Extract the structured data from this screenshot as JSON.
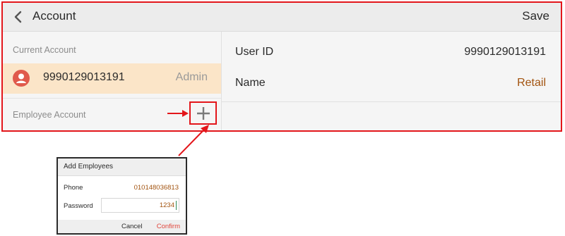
{
  "header": {
    "title": "Account",
    "save_label": "Save"
  },
  "current_account": {
    "section_label": "Current Account",
    "id": "9990129013191",
    "role": "Admin"
  },
  "employee_account": {
    "section_label": "Employee Account"
  },
  "details": {
    "user_id_label": "User ID",
    "user_id_value": "9990129013191",
    "name_label": "Name",
    "name_value": "Retail"
  },
  "dialog": {
    "title": "Add Employees",
    "phone_label": "Phone",
    "phone_value": "010148036813",
    "password_label": "Password",
    "password_value": "1234",
    "cancel_label": "Cancel",
    "confirm_label": "Confirm"
  },
  "colors": {
    "highlight": "#e3161b",
    "accent_value": "#a2530f",
    "selected_row": "#fbe5c8",
    "confirm": "#e0453b"
  },
  "icons": [
    "back-chevron-icon",
    "user-avatar-icon",
    "plus-icon",
    "arrow-icon"
  ]
}
